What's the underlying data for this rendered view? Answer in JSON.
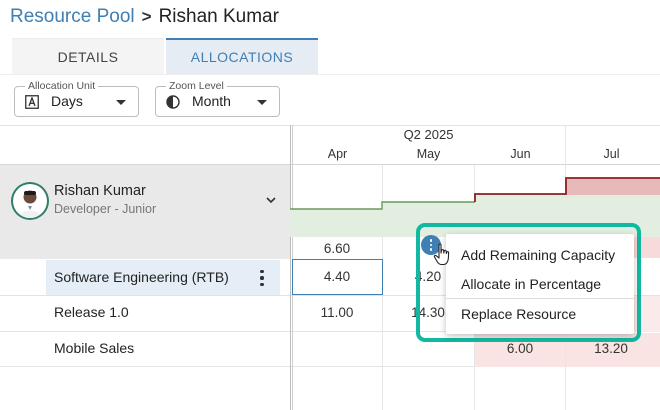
{
  "breadcrumb": {
    "parent": "Resource Pool",
    "separator": ">",
    "current": "Rishan Kumar"
  },
  "tabs": [
    {
      "label": "DETAILS",
      "active": false
    },
    {
      "label": "ALLOCATIONS",
      "active": true
    }
  ],
  "controls": {
    "allocation_unit": {
      "legend": "Allocation Unit",
      "value": "Days",
      "icon": "calendar-a-icon"
    },
    "zoom_level": {
      "legend": "Zoom Level",
      "value": "Month",
      "icon": "zoom-dial-icon"
    }
  },
  "timeline": {
    "quarter": "Q2 2025",
    "months": [
      "Apr",
      "May",
      "Jun",
      "Jul"
    ]
  },
  "resource": {
    "name": "Rishan Kumar",
    "role": "Developer - Junior",
    "total_apr": "6.60"
  },
  "projects": [
    {
      "name": "Software Engineering (RTB)",
      "apr": "4.40",
      "may": "4.20"
    },
    {
      "name": "Release 1.0",
      "apr": "11.00",
      "may": "14.30"
    },
    {
      "name": "Mobile Sales",
      "jun": "6.00",
      "jul": "13.20"
    }
  ],
  "context_menu": {
    "items": [
      "Add Remaining Capacity",
      "Allocate in Percentage",
      "Replace Resource"
    ]
  },
  "colors": {
    "accent": "#3f7fb3",
    "highlight_border": "#12b8a0",
    "capacity_fill": "#e2eedf",
    "capacity_line": "#6a9a5a",
    "overallocation_fill": "#e8b9b9",
    "overallocation_line": "#8b2020"
  }
}
